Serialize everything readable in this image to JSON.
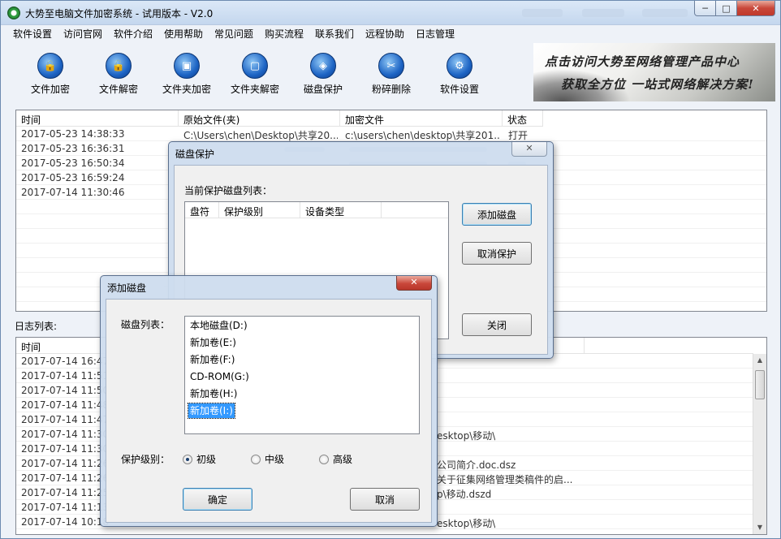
{
  "window": {
    "title": "大势至电脑文件加密系统 - 试用版本 - V2.0",
    "controls": {
      "minimize": "─",
      "maximize": "□",
      "close": "✕"
    }
  },
  "menu": [
    "软件设置",
    "访问官网",
    "软件介绍",
    "使用帮助",
    "常见问题",
    "购买流程",
    "联系我们",
    "远程协助",
    "日志管理"
  ],
  "toolbar": [
    {
      "label": "文件加密",
      "icon": "file-lock-icon"
    },
    {
      "label": "文件解密",
      "icon": "file-unlock-icon"
    },
    {
      "label": "文件夹加密",
      "icon": "folder-lock-icon"
    },
    {
      "label": "文件夹解密",
      "icon": "folder-unlock-icon"
    },
    {
      "label": "磁盘保护",
      "icon": "disk-shield-icon"
    },
    {
      "label": "粉碎删除",
      "icon": "shred-icon"
    },
    {
      "label": "软件设置",
      "icon": "gear-icon"
    }
  ],
  "banner": {
    "line1": "点击访问大势至网络管理产品中心",
    "line2": "获取全方位 一站式网络解决方案!"
  },
  "encrypted_table": {
    "columns": [
      "时间",
      "原始文件(夹)",
      "加密文件",
      "状态"
    ],
    "rows": [
      {
        "time": "2017-05-23 14:38:33",
        "original": "C:\\Users\\chen\\Desktop\\共享20...",
        "encrypted": "c:\\users\\chen\\desktop\\共享201...",
        "status": "打开"
      },
      {
        "time": "2017-05-23 16:36:31"
      },
      {
        "time": "2017-05-23 16:50:34"
      },
      {
        "time": "2017-05-23 16:59:24"
      },
      {
        "time": "2017-07-14 11:30:46"
      }
    ]
  },
  "log": {
    "label": "日志列表:",
    "columns": [
      "时间"
    ],
    "rows": [
      {
        "time": "2017-07-14 16:47",
        "detail": ""
      },
      {
        "time": "2017-07-14 11:51",
        "detail": ""
      },
      {
        "time": "2017-07-14 11:50",
        "detail": ""
      },
      {
        "time": "2017-07-14 11:48",
        "detail": ""
      },
      {
        "time": "2017-07-14 11:47",
        "detail": ""
      },
      {
        "time": "2017-07-14 11:30",
        "detail": "esktop\\移动\\"
      },
      {
        "time": "2017-07-14 11:30",
        "detail": ""
      },
      {
        "time": "2017-07-14 11:26",
        "detail": "公司简介.doc.dsz"
      },
      {
        "time": "2017-07-14 11:26",
        "detail": "关于征集网络管理类稿件的启..."
      },
      {
        "time": "2017-07-14 11:25",
        "detail": "p\\移动.dszd"
      },
      {
        "time": "2017-07-14 11:13",
        "detail": ""
      },
      {
        "time": "2017-07-14 10:18",
        "detail": "esktop\\移动\\"
      }
    ]
  },
  "disk_protect_dialog": {
    "title": "磁盘保护",
    "list_label": "当前保护磁盘列表：",
    "columns": [
      "盘符",
      "保护级别",
      "设备类型"
    ],
    "buttons": {
      "add": "添加磁盘",
      "cancel": "取消保护",
      "close": "关闭"
    }
  },
  "add_disk_dialog": {
    "title": "添加磁盘",
    "list_label": "磁盘列表：",
    "disks": [
      "本地磁盘(D:)",
      "新加卷(E:)",
      "新加卷(F:)",
      "CD-ROM(G:)",
      "新加卷(H:)",
      "新加卷(I:)"
    ],
    "selected_index": 5,
    "level_label": "保护级别：",
    "levels": [
      "初级",
      "中级",
      "高级"
    ],
    "selected_level": "初级",
    "ok": "确定",
    "cancel": "取消"
  }
}
